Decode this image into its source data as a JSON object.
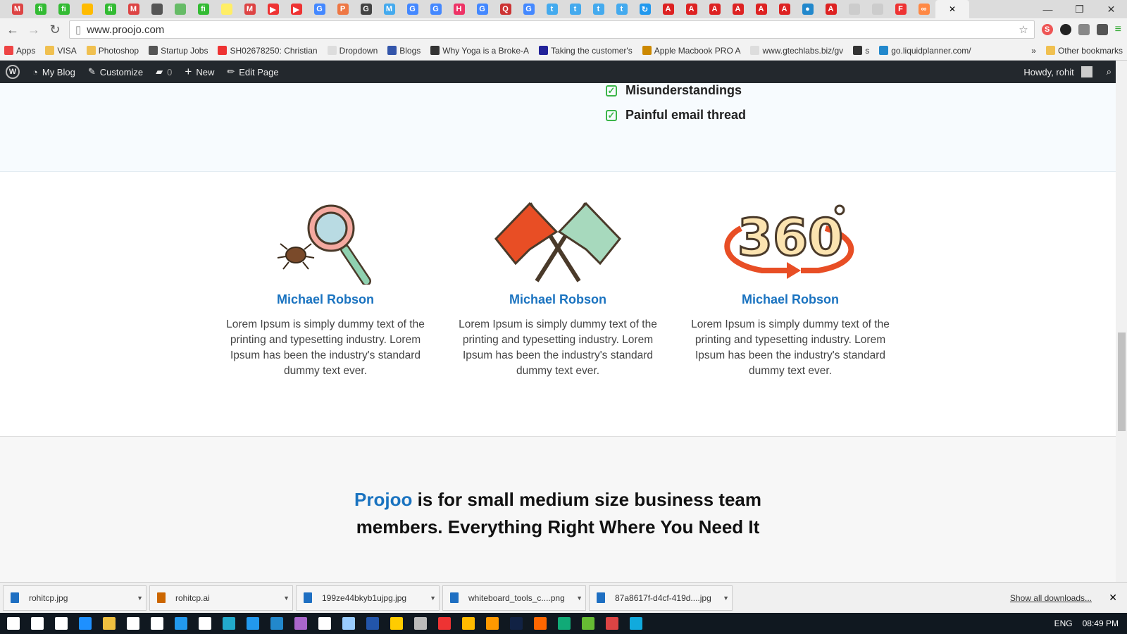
{
  "browser": {
    "tabs": [
      {
        "l": "M",
        "c": "#d44"
      },
      {
        "l": "fi",
        "c": "#3b3"
      },
      {
        "l": "fi",
        "c": "#3b3"
      },
      {
        "l": "",
        "c": "#fb0"
      },
      {
        "l": "fi",
        "c": "#3b3"
      },
      {
        "l": "M",
        "c": "#d44"
      },
      {
        "l": "",
        "c": "#555"
      },
      {
        "l": "",
        "c": "#6b6"
      },
      {
        "l": "fi",
        "c": "#3b3"
      },
      {
        "l": "",
        "c": "#fe6"
      },
      {
        "l": "M",
        "c": "#d44"
      },
      {
        "l": "▶",
        "c": "#e33"
      },
      {
        "l": "▶",
        "c": "#e33"
      },
      {
        "l": "G",
        "c": "#48f"
      },
      {
        "l": "P",
        "c": "#e74"
      },
      {
        "l": "G",
        "c": "#444"
      },
      {
        "l": "M",
        "c": "#4ae"
      },
      {
        "l": "G",
        "c": "#48f"
      },
      {
        "l": "G",
        "c": "#48f"
      },
      {
        "l": "H",
        "c": "#e36"
      },
      {
        "l": "G",
        "c": "#48f"
      },
      {
        "l": "Q",
        "c": "#c33"
      },
      {
        "l": "G",
        "c": "#48f"
      },
      {
        "l": "t",
        "c": "#4ae"
      },
      {
        "l": "t",
        "c": "#4ae"
      },
      {
        "l": "t",
        "c": "#4ae"
      },
      {
        "l": "t",
        "c": "#4ae"
      },
      {
        "l": "↻",
        "c": "#29e"
      },
      {
        "l": "A",
        "c": "#d22"
      },
      {
        "l": "A",
        "c": "#d22"
      },
      {
        "l": "A",
        "c": "#d22"
      },
      {
        "l": "A",
        "c": "#d22"
      },
      {
        "l": "A",
        "c": "#d22"
      },
      {
        "l": "A",
        "c": "#d22"
      },
      {
        "l": "●",
        "c": "#28c"
      },
      {
        "l": "A",
        "c": "#d22"
      },
      {
        "l": "",
        "c": "#ccc"
      },
      {
        "l": "",
        "c": "#ccc"
      },
      {
        "l": "F",
        "c": "#e33"
      },
      {
        "l": "∞",
        "c": "#f84"
      }
    ],
    "url": "www.proojo.com",
    "bookmarks": [
      {
        "label": "Apps",
        "color": "#e44"
      },
      {
        "label": "VISA",
        "color": "#f0c050"
      },
      {
        "label": "Photoshop",
        "color": "#f0c050"
      },
      {
        "label": "Startup Jobs",
        "color": "#555"
      },
      {
        "label": "SH02678250: Christian",
        "color": "#e33"
      },
      {
        "label": "Dropdown",
        "color": "#ddd"
      },
      {
        "label": "Blogs",
        "color": "#35a"
      },
      {
        "label": "Why Yoga is a Broke-A",
        "color": "#333"
      },
      {
        "label": "Taking the customer's",
        "color": "#229"
      },
      {
        "label": "Apple Macbook PRO A",
        "color": "#c80"
      },
      {
        "label": "www.gtechlabs.biz/gv",
        "color": "#ddd"
      },
      {
        "label": "s",
        "color": "#333"
      },
      {
        "label": "go.liquidplanner.com/",
        "color": "#28c"
      }
    ],
    "more": "»",
    "other_bookmarks": "Other bookmarks"
  },
  "wp": {
    "site": "My Blog",
    "customize": "Customize",
    "comments": "0",
    "new": "New",
    "edit": "Edit Page",
    "howdy": "Howdy, rohit"
  },
  "checklist": [
    "Misunderstandings",
    "Painful email thread"
  ],
  "features": [
    {
      "title": "Michael Robson",
      "text": "Lorem Ipsum is simply dummy text of the printing and typesetting industry. Lorem Ipsum has been the industry's standard dummy text ever.",
      "icon": "magnifier-bug"
    },
    {
      "title": "Michael Robson",
      "text": "Lorem Ipsum is simply dummy text of the printing and typesetting industry. Lorem Ipsum has been the industry's standard dummy text ever.",
      "icon": "crossed-flags"
    },
    {
      "title": "Michael Robson",
      "text": "Lorem Ipsum is simply dummy text of the printing and typesetting industry. Lorem Ipsum has been the industry's standard dummy text ever.",
      "icon": "360-degree"
    }
  ],
  "tagline": {
    "brand": "Projoo",
    "rest": " is for small medium size business team members. Everything Right Where You Need It"
  },
  "downloads": {
    "items": [
      "rohitcp.jpg",
      "rohitcp.ai",
      "199ze44bkyb1ujpg.jpg",
      "whiteboard_tools_c....png",
      "87a8617f-d4cf-419d....jpg"
    ],
    "show_all": "Show all downloads..."
  },
  "taskbar": {
    "lang": "ENG",
    "time": "08:49 PM",
    "colors": [
      "#fff",
      "#fff",
      "#fff",
      "#1e90ff",
      "#f0c040",
      "#fff",
      "#fff",
      "#29e",
      "#fff",
      "#2ac",
      "#29e",
      "#28c",
      "#a6c",
      "#fff",
      "#9cf",
      "#25a",
      "#fc0",
      "#bbb",
      "#e33",
      "#fb0",
      "#f90",
      "#124",
      "#f60",
      "#1a7",
      "#6b3",
      "#d44",
      "#1ad"
    ]
  },
  "colors": {
    "accent": "#1a73c0",
    "check": "#3cb54a",
    "adminbar": "#23282d"
  }
}
